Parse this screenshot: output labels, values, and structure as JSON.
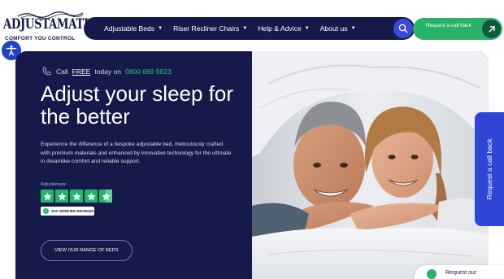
{
  "brand": {
    "name": "ADJUSTAMATIC",
    "tagline": "COMFORT YOU CONTROL",
    "color": "#151a4a"
  },
  "nav": {
    "items": [
      {
        "label": "Adjustable Beds"
      },
      {
        "label": "Riser Recliner Chairs"
      },
      {
        "label": "Help & Advice"
      },
      {
        "label": "About us"
      }
    ]
  },
  "header": {
    "callback_label": "Request a call back",
    "search_icon": "search-icon",
    "arrow_icon": "arrow-up-right-icon"
  },
  "hero": {
    "call_prefix": "Call",
    "call_free": "FREE",
    "call_mid": "today on",
    "phone": "0800 689 9823",
    "headline": "Adjust your sleep for the better",
    "description": "Experience the difference of a bespoke adjustable bed, meticulously crafted with premium materials and enhanced by innovative technology for the ultimate in dreamlike comfort and reliable support.",
    "trustpilot_label": "Adjustamatic",
    "rating_stars": 4.5,
    "reviews_badge": "333 VERIFIED REVIEWS",
    "cta": "VIEW OUR RANGE OF BEDS"
  },
  "side_tab": {
    "label": "Request a call back"
  },
  "bubble": {
    "label": "Request our"
  },
  "colors": {
    "navy": "#151a4a",
    "green": "#27b36a",
    "blue": "#2f45d6",
    "trustpilot": "#1fb86a"
  }
}
